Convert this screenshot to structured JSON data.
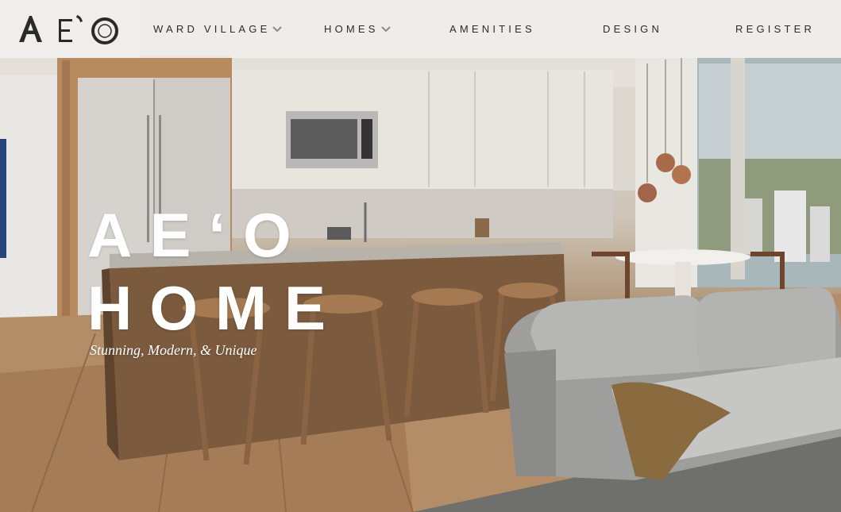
{
  "brand": {
    "logo_text": "AE'O",
    "logo_icon": "aeo-logo-icon"
  },
  "nav": {
    "items": [
      {
        "label": "WARD VILLAGE",
        "has_dropdown": true
      },
      {
        "label": "HOMES",
        "has_dropdown": true
      },
      {
        "label": "AMENITIES",
        "has_dropdown": false
      },
      {
        "label": "DESIGN",
        "has_dropdown": false
      },
      {
        "label": "REGISTER",
        "has_dropdown": false
      }
    ]
  },
  "hero": {
    "line1": "AE‘O",
    "line2": "HOME",
    "subtitle": "Stunning, Modern, & Unique",
    "image_subject": "kitchen-living-room-photo"
  },
  "colors": {
    "nav_background": "#efeeec",
    "nav_text": "#2b2b2b",
    "hero_text": "#ffffff"
  }
}
